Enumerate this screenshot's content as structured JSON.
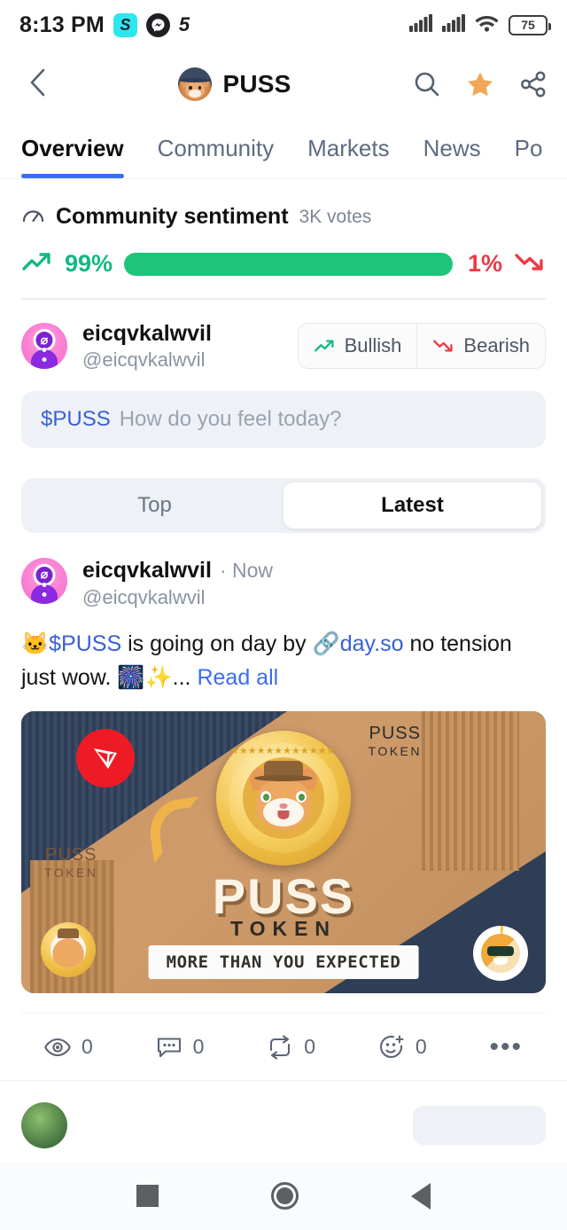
{
  "status_bar": {
    "time": "8:13 PM",
    "app_icons": [
      "skype-like-icon",
      "messenger-icon",
      "s-brand-icon"
    ],
    "signal_icon_1": "cellular-signal-icon",
    "signal_icon_2": "cellular-signal-icon",
    "wifi_icon": "wifi-icon",
    "battery_level": "75"
  },
  "header": {
    "back_icon": "chevron-left-icon",
    "logo_icon": "puss-cat-logo-icon",
    "title": "PUSS",
    "search_icon": "search-icon",
    "favorite_icon": "star-filled-icon",
    "share_icon": "share-icon"
  },
  "tabs": {
    "items": [
      {
        "label": "Overview",
        "active": true
      },
      {
        "label": "Community",
        "active": false
      },
      {
        "label": "Markets",
        "active": false
      },
      {
        "label": "News",
        "active": false
      },
      {
        "label": "Po",
        "active": false
      }
    ],
    "indicator_color": "#3a6df0"
  },
  "sentiment": {
    "icon": "gauge-icon",
    "title": "Community sentiment",
    "votes": "3K votes",
    "bullish_percent": "99%",
    "bearish_percent": "1%",
    "bullish_icon": "trend-up-icon",
    "bearish_icon": "trend-down-icon",
    "bullish_color": "#1dc47a",
    "bearish_color": "#ef3a44",
    "bullish_value": 99,
    "bearish_value": 1
  },
  "composer": {
    "avatar_icon": "user-avatar",
    "display_name": "eicqvkalwvil",
    "handle": "@eicqvkalwvil",
    "bullish_label": "Bullish",
    "bearish_label": "Bearish",
    "bullish_icon": "trend-up-icon",
    "bearish_icon": "trend-down-icon",
    "input_ticker": "$PUSS",
    "input_placeholder": "How do you feel today?"
  },
  "feed_filter": {
    "options": [
      {
        "label": "Top",
        "active": false
      },
      {
        "label": "Latest",
        "active": true
      }
    ]
  },
  "post": {
    "avatar_icon": "user-avatar",
    "display_name": "eicqvkalwvil",
    "timestamp": "Now",
    "handle": "@eicqvkalwvil",
    "text_emoji_1": "🐱",
    "text_ticker": "$PUSS",
    "text_part_1": " is going on day by ",
    "link_icon": "link-icon",
    "text_link": "day.so",
    "text_part_2": " no tension just wow. ",
    "text_emoji_2": "🎆",
    "text_emoji_3": "✨",
    "text_ellipsis": "...",
    "read_all_label": "Read all",
    "media": {
      "alt_name": "puss-token-promo-banner",
      "tron_icon": "tron-logo-icon",
      "tag_top_right_line1": "PUSS",
      "tag_top_right_line2": "TOKEN",
      "tag_bottom_left_line1": "PUSS",
      "tag_bottom_left_line2": "TOKEN",
      "brand_word": "PUSS",
      "brand_sub": "TOKEN",
      "slogan": "MORE THAN YOU EXPECTED",
      "coin_icon": "puss-gold-coin-icon",
      "mini_coin_icon": "puss-mini-coin-icon",
      "sun_badge_icon": "sun-pepe-badge-icon"
    },
    "engagement": [
      {
        "icon": "eye-icon",
        "name": "views",
        "count": "0"
      },
      {
        "icon": "comment-icon",
        "name": "comments",
        "count": "0"
      },
      {
        "icon": "repost-icon",
        "name": "reposts",
        "count": "0"
      },
      {
        "icon": "reaction-icon",
        "name": "reactions",
        "count": "0"
      }
    ],
    "more_icon": "more-horizontal-icon"
  },
  "next_post": {
    "avatar_icon": "user-avatar",
    "display_name": ""
  },
  "nav_bar": {
    "recents_icon": "square-recents-icon",
    "home_icon": "circle-home-icon",
    "back_icon": "triangle-back-icon"
  }
}
